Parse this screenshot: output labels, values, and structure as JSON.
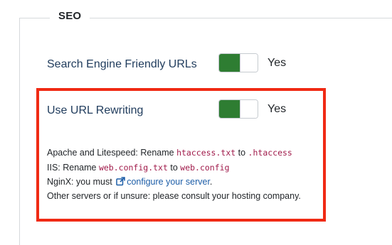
{
  "section": {
    "legend": "SEO"
  },
  "sef_urls": {
    "label": "Search Engine Friendly URLs",
    "value": "Yes",
    "enabled": true
  },
  "url_rewriting": {
    "label": "Use URL Rewriting",
    "value": "Yes",
    "enabled": true,
    "help": {
      "apache_prefix": "Apache and Litespeed: Rename ",
      "apache_file_from": "htaccess.txt",
      "apache_to": " to ",
      "apache_file_to": ".htaccess",
      "iis_prefix": "IIS: Rename ",
      "iis_file_from": "web.config.txt",
      "iis_to": " to ",
      "iis_file_to": "web.config",
      "nginx_prefix": "NginX: you must ",
      "nginx_link": "configure your server",
      "nginx_suffix": ".",
      "other": "Other servers or if unsure: please consult your hosting company."
    }
  },
  "colors": {
    "switch_on": "#2e7d32",
    "highlight_border": "#f02a14",
    "code_text": "#a01a4a",
    "link": "#1d5ea8",
    "label_text": "#1f3b5c"
  },
  "icons": {
    "external_link": "external-link-icon"
  }
}
